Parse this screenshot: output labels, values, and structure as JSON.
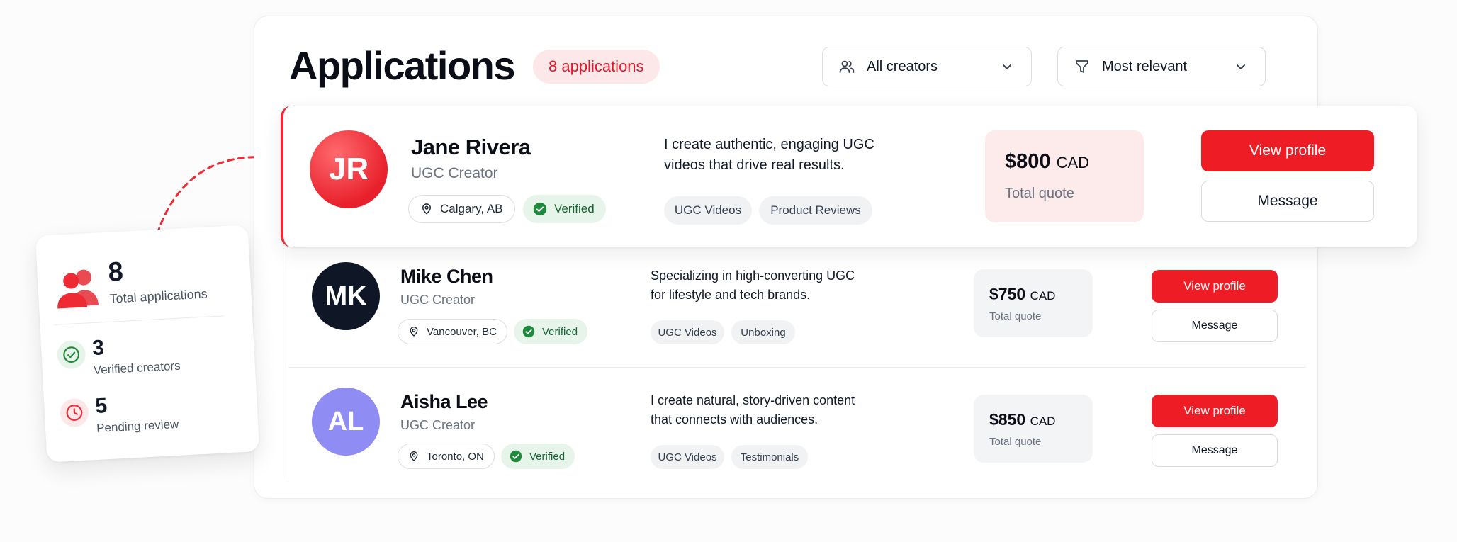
{
  "header": {
    "title": "Applications",
    "count_badge": "8 applications",
    "filter_creators": {
      "label": "All creators",
      "icon": "users-icon"
    },
    "sort": {
      "label": "Most relevant",
      "icon": "filter-icon"
    }
  },
  "colors": {
    "accent": "#ee1c25",
    "verified_bg": "#e6f4ea",
    "verified_text": "#166534"
  },
  "applications": [
    {
      "initials": "JR",
      "name": "Jane Rivera",
      "role": "UGC Creator",
      "location": "Calgary, AB",
      "verified": "Verified",
      "description_line1": "I create authentic, engaging UGC",
      "description_line2": "videos that drive real results.",
      "tags": [
        "UGC Videos",
        "Product Reviews"
      ],
      "amount": "$800",
      "currency": "CAD",
      "quote_label": "Total quote",
      "view_label": "View profile",
      "message_label": "Message"
    },
    {
      "initials": "MK",
      "name": "Mike Chen",
      "role": "UGC Creator",
      "location": "Vancouver, BC",
      "verified": "Verified",
      "description_line1": "Specializing in high-converting UGC",
      "description_line2": "for lifestyle and tech brands.",
      "tags": [
        "UGC Videos",
        "Unboxing"
      ],
      "amount": "$750",
      "currency": "CAD",
      "quote_label": "Total quote",
      "view_label": "View profile",
      "message_label": "Message"
    },
    {
      "initials": "AL",
      "name": "Aisha Lee",
      "role": "UGC Creator",
      "location": "Toronto, ON",
      "verified": "Verified",
      "description_line1": "I create natural, story-driven content",
      "description_line2": "that connects with audiences.",
      "tags": [
        "UGC Videos",
        "Testimonials"
      ],
      "amount": "$850",
      "currency": "CAD",
      "quote_label": "Total quote",
      "view_label": "View profile",
      "message_label": "Message"
    }
  ],
  "stats": {
    "total": {
      "value": "8",
      "label": "Total applications"
    },
    "verified": {
      "value": "3",
      "label": "Verified creators"
    },
    "pending": {
      "value": "5",
      "label": "Pending review"
    }
  }
}
